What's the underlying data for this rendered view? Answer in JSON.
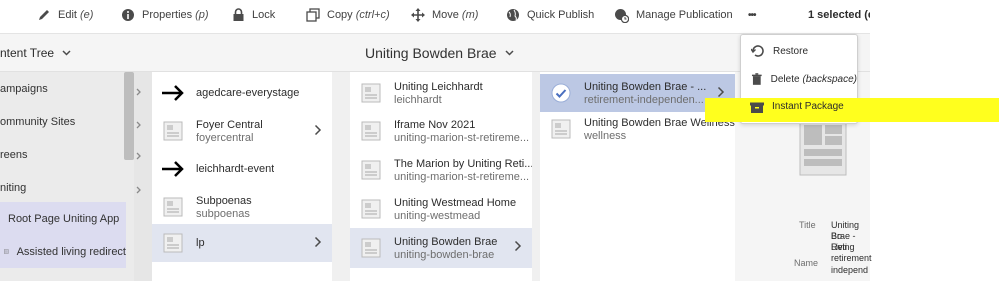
{
  "toolbar": {
    "edit_label": "Edit",
    "edit_kbd": "(e)",
    "properties_label": "Properties",
    "properties_kbd": "(p)",
    "lock_label": "Lock",
    "copy_label": "Copy",
    "copy_kbd": "(ctrl+c)",
    "move_label": "Move",
    "move_kbd": "(m)",
    "quick_publish_label": "Quick Publish",
    "manage_publication_label": "Manage Publication",
    "more_label": "•••",
    "selected_label": "1 selected (es"
  },
  "header": {
    "rail_title": "ntent Tree",
    "page_title": "Uniting Bowden Brae"
  },
  "rail": {
    "items": [
      {
        "label": "ampaigns"
      },
      {
        "label": "ommunity Sites"
      },
      {
        "label": "reens"
      },
      {
        "label": "niting"
      },
      {
        "label": "Root Page Uniting App"
      },
      {
        "label": "Assisted living redirect"
      }
    ]
  },
  "col1": {
    "rows": [
      {
        "title": "agedcare-everystage",
        "name": ""
      },
      {
        "title": "Foyer Central",
        "name": "foyercentral"
      },
      {
        "title": "leichhardt-event",
        "name": ""
      },
      {
        "title": "Subpoenas",
        "name": "subpoenas"
      },
      {
        "title": "lp",
        "name": ""
      }
    ]
  },
  "col2": {
    "rows": [
      {
        "title": "Uniting Leichhardt",
        "name": "leichhardt"
      },
      {
        "title": "Iframe Nov 2021",
        "name": "uniting-marion-st-retireme..."
      },
      {
        "title": "The Marion by Uniting Reti...",
        "name": "uniting-marion-st-retireme..."
      },
      {
        "title": "Uniting Westmead Home",
        "name": "uniting-westmead"
      },
      {
        "title": "Uniting Bowden Brae",
        "name": "uniting-bowden-brae"
      }
    ]
  },
  "col3": {
    "rows": [
      {
        "title": "Uniting Bowden Brae - ...",
        "name": "retirement-independen..."
      },
      {
        "title": "Uniting Bowden Brae Wellness...",
        "name": "wellness"
      }
    ]
  },
  "detail": {
    "title_label": "Title",
    "title_value_1": "Uniting Bo",
    "title_value_2": "Brae - Reti",
    "title_value_3": "Living",
    "name_label": "Name",
    "name_value_1": "retirement",
    "name_value_2": "independ"
  },
  "menu": {
    "restore_label": "Restore",
    "delete_label": "Delete",
    "delete_kbd": "(backspace)",
    "instant_package_label": "Instant Package"
  },
  "colors": {
    "highlight": "#ffff1e",
    "selection": "#e1e5f0",
    "selection_strong": "#bcc8e4",
    "rail_selected": "#dcdcf0"
  }
}
